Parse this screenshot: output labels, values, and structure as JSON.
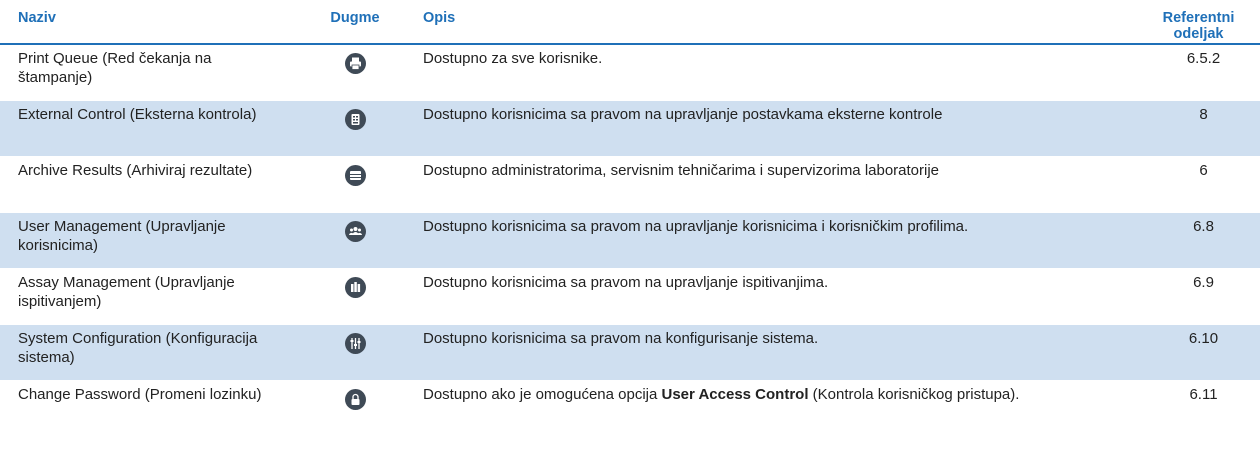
{
  "table": {
    "headers": {
      "name": "Naziv",
      "button": "Dugme",
      "description": "Opis",
      "reference": "Referentni odeljak"
    },
    "rows": [
      {
        "name": "Print Queue (Red čekanja na štampanje)",
        "icon": "print-icon",
        "description": "Dostupno za sve korisnike.",
        "reference": "6.5.2"
      },
      {
        "name": "External Control (Eksterna kontrola)",
        "icon": "external-control-icon",
        "description": "Dostupno korisnicima sa pravom na upravljanje postavkama eksterne kontrole",
        "reference": "8"
      },
      {
        "name": "Archive Results (Arhiviraj rezultate)",
        "icon": "archive-icon",
        "description": "Dostupno administratorima, servisnim tehničarima i supervizorima laboratorije",
        "reference": "6"
      },
      {
        "name": "User Management (Upravljanje korisnicima)",
        "icon": "users-icon",
        "description": "Dostupno korisnicima sa pravom na upravljanje korisnicima i korisničkim profilima.",
        "reference": "6.8"
      },
      {
        "name": "Assay Management (Upravljanje ispitivanjem)",
        "icon": "assay-icon",
        "description": "Dostupno korisnicima sa pravom na upravljanje ispitivanjima.",
        "reference": "6.9"
      },
      {
        "name": "System Configuration (Konfiguracija sistema)",
        "icon": "sliders-icon",
        "description": "Dostupno korisnicima sa pravom na konfigurisanje sistema.",
        "reference": "6.10"
      },
      {
        "name": "Change Password (Promeni lozinku)",
        "icon": "lock-icon",
        "description_prefix": "Dostupno ako je omogućena opcija ",
        "description_bold": "User Access Control",
        "description_suffix": " (Kontrola korisničkog pristupa).",
        "reference": "6.11"
      }
    ]
  }
}
